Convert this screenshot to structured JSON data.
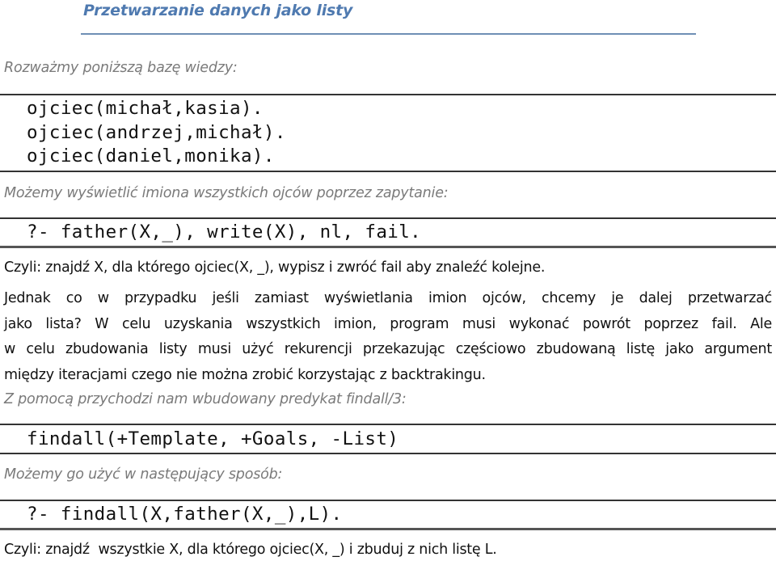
{
  "title": "Przetwarzanie danych jako listy",
  "intro": "Rozważmy poniższą bazę wiedzy:",
  "knowledge_base": [
    "ojciec(michał,kasia).",
    "ojciec(andrzej,michał).",
    "ojciec(daniel,monika)."
  ],
  "query_intro": "Możemy wyświetlić imiona wszystkich ojców poprzez zapytanie:",
  "query": "?- father(X,_), write(X), nl, fail.",
  "explanation1": "Czyli: znajdź X, dla którego ojciec(X, _), wypisz i zwróć fail aby znaleźć kolejne.",
  "paragraph": [
    "Jednak co w przypadku jeśli zamiast wyświetlania imion ojców, chcemy je dalej przetwarzać",
    "jako lista? W celu uzyskania wszystkich imion, program musi wykonać powrót poprzez fail. Ale",
    "w celu zbudowania listy musi użyć rekurencji przekazując częściowo zbudowaną listę jako argument",
    "między iteracjami czego nie można zrobić korzystając z backtrakingu."
  ],
  "findall_intro": "Z pomocą przychodzi nam wbudowany predykat findall/3:",
  "findall_signature": "findall(+Template, +Goals, -List)",
  "usage_intro": "Możemy go użyć w następujący sposób:",
  "findall_query": "?- findall(X,father(X,_),L).",
  "explanation2": "Czyli: znajdź  wszystkie X, dla którego ojciec(X, _) i zbuduj z nich listę L."
}
